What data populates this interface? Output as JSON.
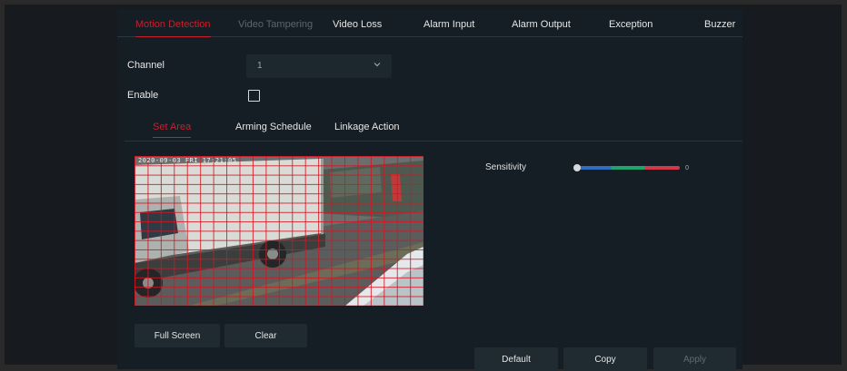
{
  "tabs": [
    {
      "label": "Motion Detection",
      "state": "active"
    },
    {
      "label": "Video Tampering",
      "state": "disabled"
    },
    {
      "label": "Video Loss",
      "state": "normal"
    },
    {
      "label": "Alarm Input",
      "state": "normal"
    },
    {
      "label": "Alarm Output",
      "state": "normal"
    },
    {
      "label": "Exception",
      "state": "normal"
    },
    {
      "label": "Buzzer",
      "state": "normal"
    }
  ],
  "form": {
    "channel_label": "Channel",
    "channel_value": "1",
    "enable_label": "Enable",
    "enable_checked": false
  },
  "subtabs": [
    {
      "label": "Set Area",
      "state": "active"
    },
    {
      "label": "Arming Schedule",
      "state": "normal"
    },
    {
      "label": "Linkage Action",
      "state": "normal"
    }
  ],
  "video": {
    "osd_text": "2020-09-03 FRI 17:21:05"
  },
  "sensitivity": {
    "label": "Sensitivity",
    "value": "0",
    "level_fraction": 0.0
  },
  "buttons": {
    "full_screen": "Full Screen",
    "clear": "Clear",
    "default": "Default",
    "copy": "Copy",
    "apply": "Apply"
  },
  "colors": {
    "accent": "#c91f2c",
    "panel_bg": "#151e24",
    "grid_line": "#d61422"
  }
}
